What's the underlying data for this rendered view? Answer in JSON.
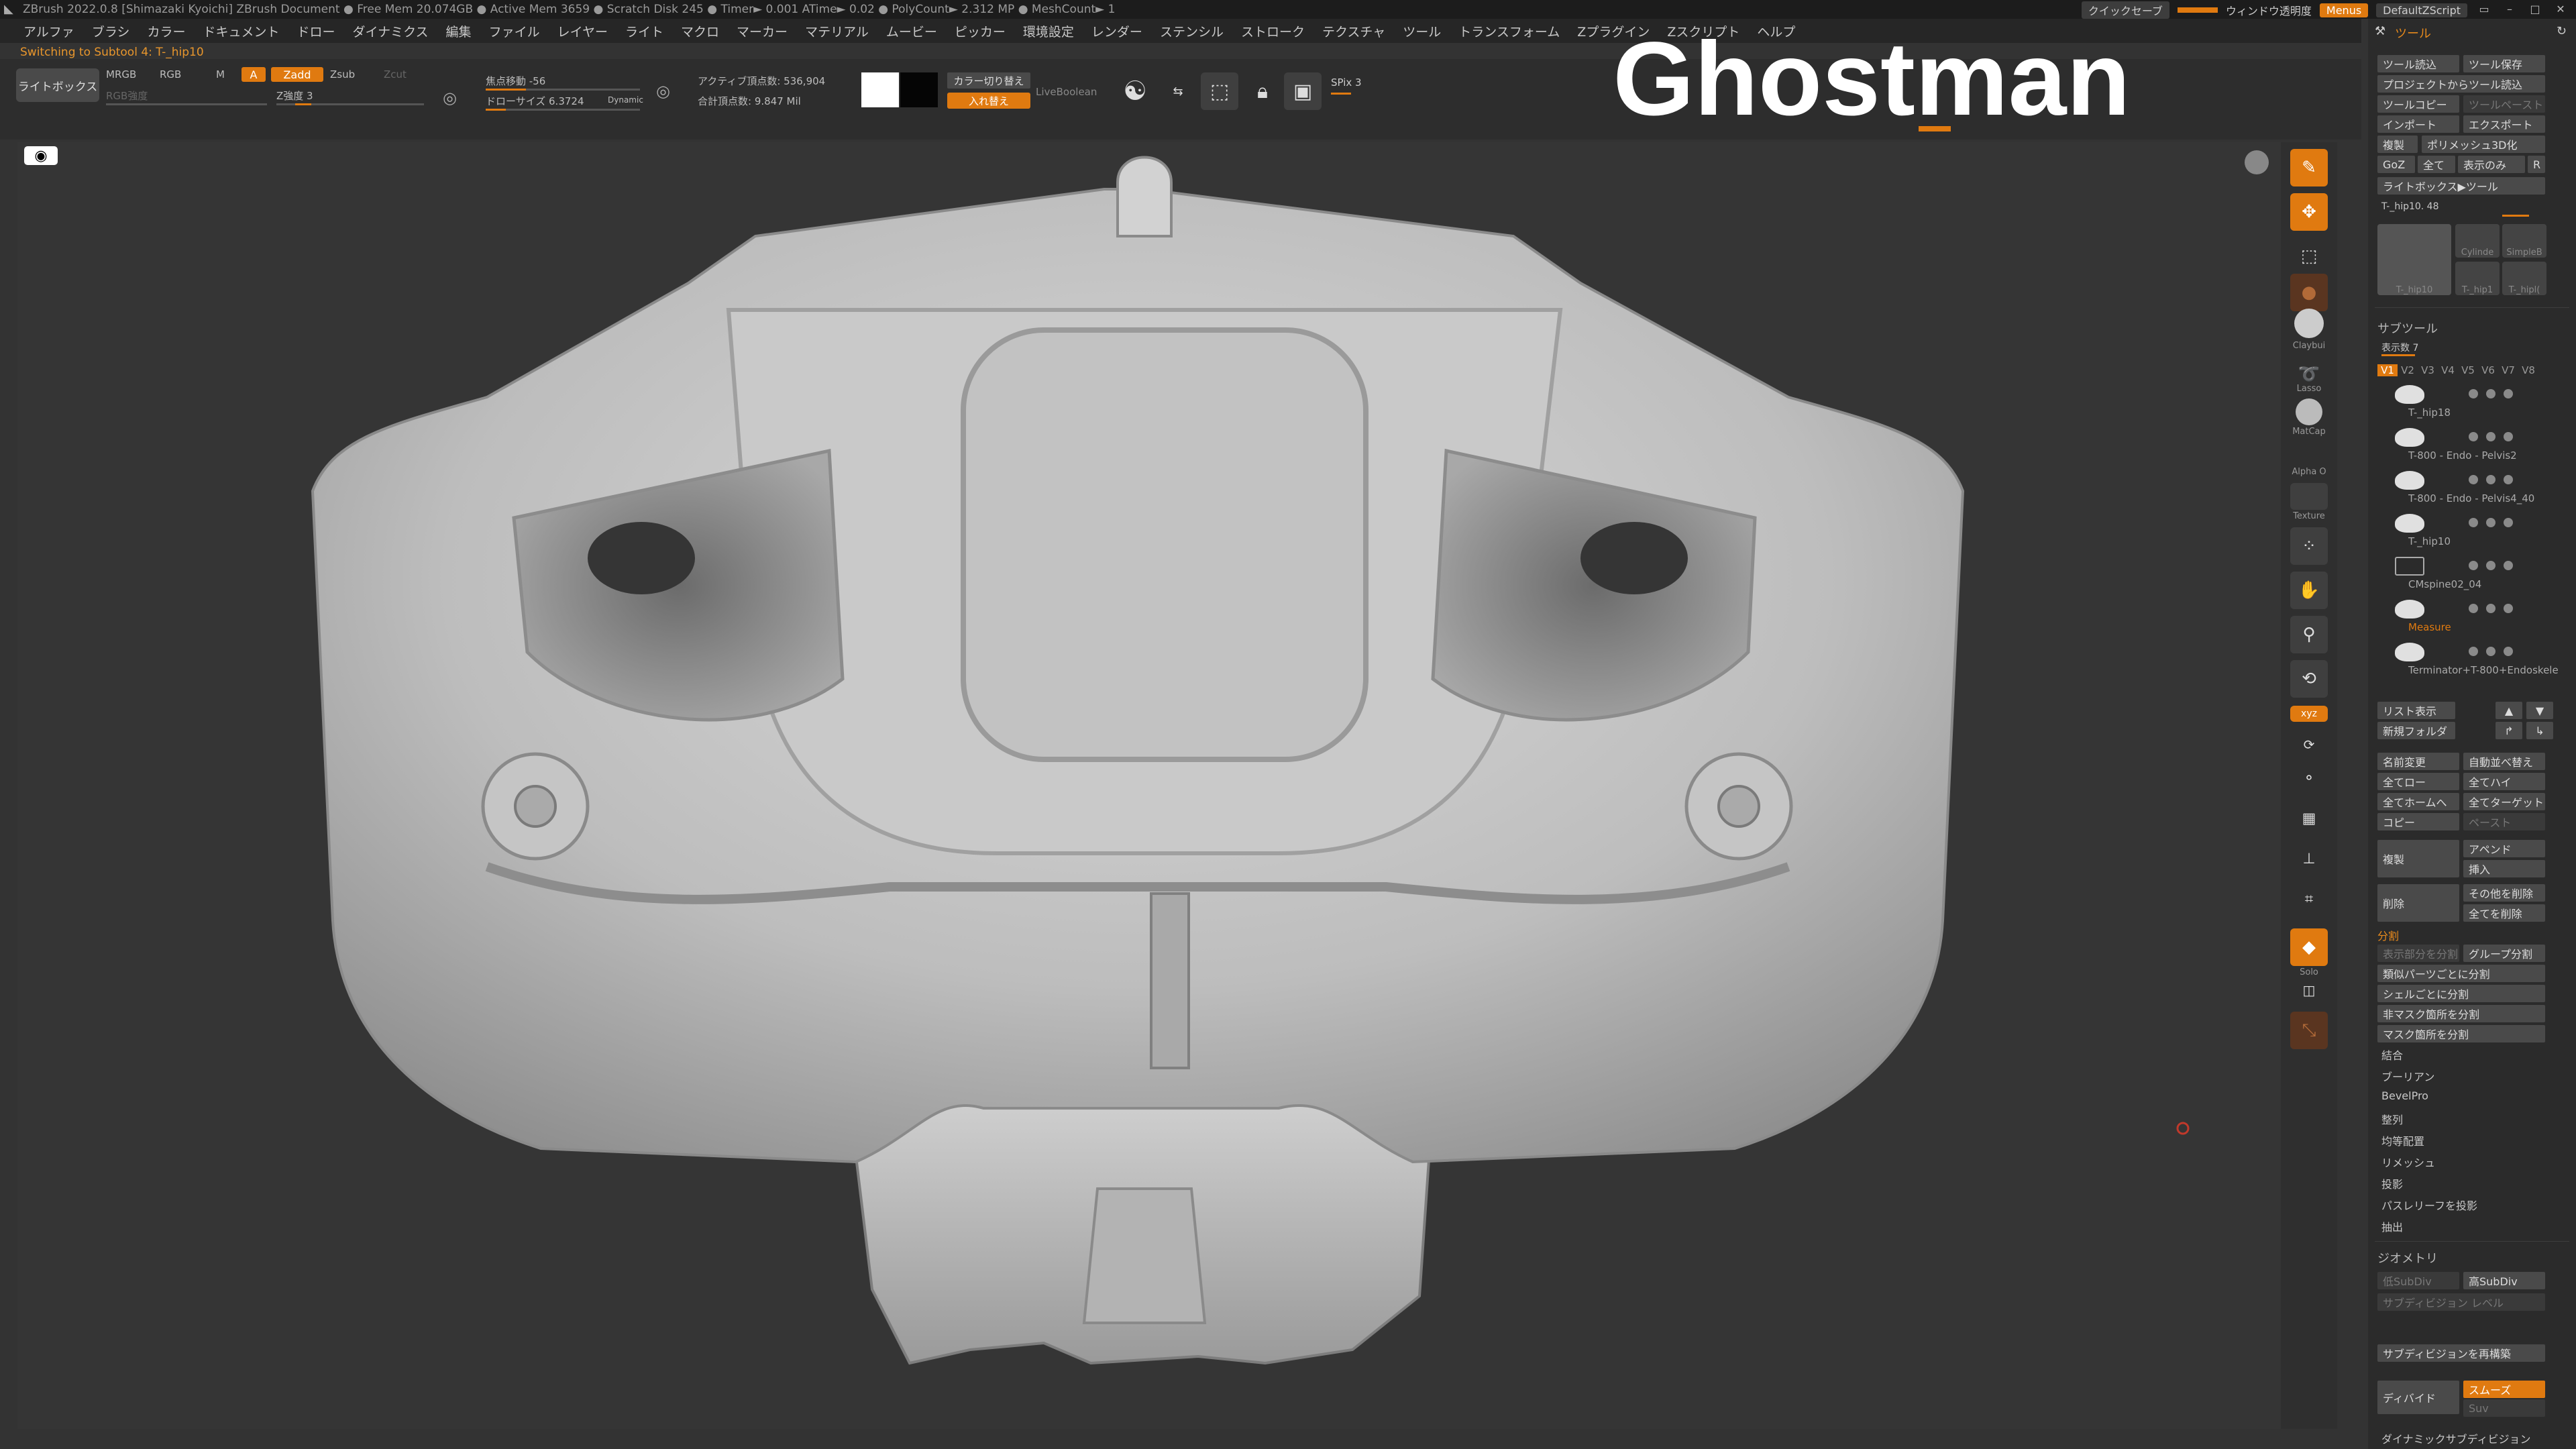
{
  "titlebar": {
    "text": "ZBrush 2022.0.8 [Shimazaki Kyoichi]   ZBrush Document   ● Free Mem 20.074GB ● Active Mem 3659 ● Scratch Disk 245 ● Timer► 0.001 ATime► 0.02 ● PolyCount► 2.312 MP ● MeshCount► 1",
    "quicksave": "クイックセーブ",
    "window_transparency": "ウィンドウ透明度",
    "menus": "Menus",
    "default_script": "DefaultZScript"
  },
  "menubar": [
    "アルファ",
    "ブラシ",
    "カラー",
    "ドキュメント",
    "ドロー",
    "ダイナミクス",
    "編集",
    "ファイル",
    "レイヤー",
    "ライト",
    "マクロ",
    "マーカー",
    "マテリアル",
    "ムービー",
    "ピッカー",
    "環境設定",
    "レンダー",
    "ステンシル",
    "ストローク",
    "テクスチャ",
    "ツール",
    "トランスフォーム",
    "Zプラグイン",
    "Zスクリプト",
    "ヘルプ"
  ],
  "notice": "Switching to Subtool 4: T-_hip10",
  "toolbar": {
    "lightbox": "ライトボックス",
    "mrgb": "MRGB",
    "rgb": "RGB",
    "m": "M",
    "a": "A",
    "zadd": "Zadd",
    "zsub": "Zsub",
    "zcut": "Zcut",
    "rgb_intensity": "RGB強度",
    "z_intensity": "Z強度 3",
    "focal_shift": "焦点移動 -56",
    "draw_size": "ドローサイズ 6.3724",
    "dynamic": "Dynamic",
    "active_points": "アクティブ頂点数: 536,904",
    "total_points": "合計頂点数: 9.847 Mil",
    "color_switch": "カラー切り替え",
    "swap": "入れ替え",
    "live_boolean": "LiveBoolean",
    "spix": "SPix 3"
  },
  "header_title": "Ghostman",
  "shelf": [
    "Edit",
    "Move",
    "",
    "Claybui",
    "Lasso",
    "MatCap",
    "Alpha O",
    "Texture",
    "",
    "",
    "",
    "",
    "Copy",
    "",
    "",
    "Solo",
    "",
    "Transp"
  ],
  "palette": {
    "tool_title": "ツール",
    "tool_buttons": [
      [
        "ツール読込",
        "ツール保存"
      ],
      [
        "プロジェクトからツール読込",
        ""
      ],
      [
        "ツールコピー",
        "ツールペースト"
      ],
      [
        "インポート",
        "エクスポート"
      ],
      [
        "複製",
        "ポリメッシュ3D化"
      ],
      [
        "GoZ",
        "全て",
        "表示のみ",
        "R"
      ],
      [
        "ライトボックス▶ツール",
        ""
      ]
    ],
    "tool_name": "T-_hip10. 48",
    "thumbs": [
      "T-_hip10",
      "Cylinde",
      "SimpleB",
      "T-_hip1",
      "T-_hipl("
    ],
    "subtool_title": "サブツール",
    "display_count": "表示数 7",
    "versions": [
      "V1",
      "V2",
      "V3",
      "V4",
      "V5",
      "V6",
      "V7",
      "V8"
    ],
    "subtools": [
      "T-_hip18",
      "T-800 - Endo - Pelvis2",
      "T-800 - Endo - Pelvis4_40",
      "T-_hip10",
      "CMspine02_04",
      "Measure",
      "Terminator+T-800+Endoskele"
    ],
    "list_buttons": [
      "リスト表示",
      "新規フォルダ"
    ],
    "action_buttons": [
      [
        "名前変更",
        "自動並べ替え"
      ],
      [
        "全てロー",
        "全てハイ"
      ],
      [
        "全てホームへ",
        "全てターゲット"
      ],
      [
        "コピー",
        "ペースト"
      ]
    ],
    "dup": "複製",
    "append": "アペンド",
    "insert": "挿入",
    "delete": "削除",
    "del_other": "その他を削除",
    "del_all": "全てを削除",
    "split_title": "分割",
    "split_buttons": [
      "グループ分割",
      "類似パーツごとに分割",
      "シェルごとに分割",
      "非マスク箇所を分割",
      "マスク箇所を分割"
    ],
    "split_hidden": "表示部分を分割",
    "menu_items": [
      "結合",
      "ブーリアン",
      "BevelPro",
      "整列",
      "均等配置",
      "リメッシュ",
      "投影",
      "パスレリーフを投影",
      "抽出"
    ],
    "geometry_title": "ジオメトリ",
    "geo_buttons": [
      "低SubDiv",
      "高SubDiv",
      "サブディビジョン レベル",
      "サブディビジョンを再構築",
      "スムーズ",
      "Suv",
      "ディバイド",
      "ダイナミックサブディビジョン"
    ]
  }
}
